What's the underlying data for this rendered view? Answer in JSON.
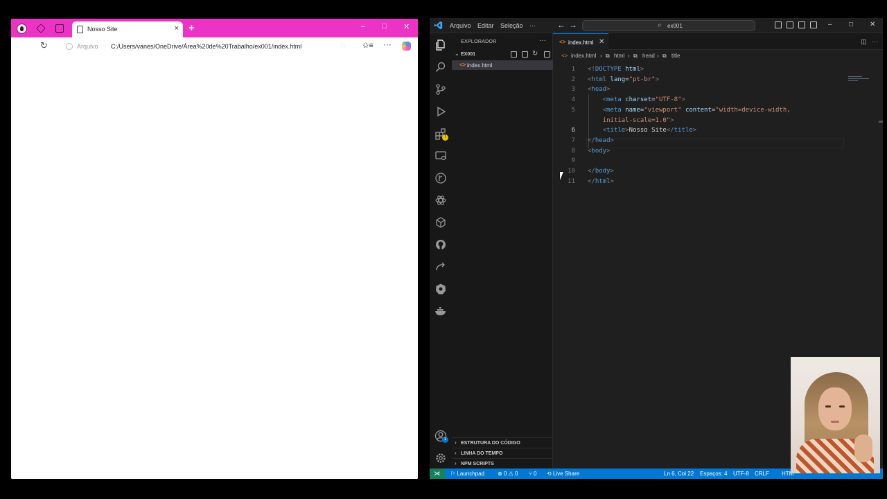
{
  "browser": {
    "tab_title": "Nosso Site",
    "new_tab_symbol": "+",
    "tab_close_symbol": "×",
    "file_label": "Arquivo",
    "url": "C:/Users/vanes/OneDrive/Área%20de%20Trabalho/ex001/index.html",
    "titlebar_color": "#ec33c5",
    "window_controls": [
      "–",
      "□",
      "✕"
    ]
  },
  "vscode": {
    "menu": [
      "Arquivo",
      "Editar",
      "Seleção",
      "···"
    ],
    "search_text": "ex001",
    "explorer_title": "EXPLORADOR",
    "explorer_more": "···",
    "folder_name": "EX001",
    "file_name": "index.html",
    "sidebar_sections": [
      "ESTRUTURA DO CÓDIGO",
      "LINHA DO TEMPO",
      "NPM SCRIPTS"
    ],
    "editor_tab": "index.html",
    "breadcrumbs": [
      "index.html",
      "html",
      "head",
      "title"
    ],
    "window_controls": [
      "–",
      "□",
      "✕"
    ],
    "accent_color": "#0078d4",
    "code_lines": [
      {
        "n": "1",
        "html": "<span class='tg'>&lt;!</span><span class='tn'>DOCTYPE</span> <span class='at'>html</span><span class='tg'>&gt;</span>"
      },
      {
        "n": "2",
        "html": "<span class='tg'>&lt;</span><span class='tn'>html</span> <span class='at'>lang</span><span class='tx'>=</span><span class='sv'>\"pt-br\"</span><span class='tg'>&gt;</span>"
      },
      {
        "n": "3",
        "html": "<span class='tg'>&lt;</span><span class='tn'>head</span><span class='tg'>&gt;</span>"
      },
      {
        "n": "4",
        "html": "    <span class='tg'>&lt;</span><span class='tn'>meta</span> <span class='at'>charset</span><span class='tx'>=</span><span class='sv'>\"UTF-8\"</span><span class='tg'>&gt;</span>"
      },
      {
        "n": "5",
        "html": "    <span class='tg'>&lt;</span><span class='tn'>meta</span> <span class='at'>name</span><span class='tx'>=</span><span class='sv'>\"viewport\"</span> <span class='at'>content</span><span class='tx'>=</span><span class='sv'>\"width=device-width,</span>"
      },
      {
        "n": "",
        "html": "    <span class='sv'>initial-scale=1.0\"</span><span class='tg'>&gt;</span>"
      },
      {
        "n": "6",
        "html": "    <span class='tg'>&lt;</span><span class='tn'>title</span><span class='tg'>&gt;</span><span class='tx'>Nosso Site</span><span class='tg'>&lt;/</span><span class='tn'>title</span><span class='tg'>&gt;</span>"
      },
      {
        "n": "7",
        "html": "<span class='tg'>&lt;/</span><span class='tn'>head</span><span class='tg'>&gt;</span>"
      },
      {
        "n": "8",
        "html": "<span class='tg'>&lt;</span><span class='tn'>body</span><span class='tg'>&gt;</span>"
      },
      {
        "n": "9",
        "html": ""
      },
      {
        "n": "10",
        "html": "<span class='tg'>&lt;/</span><span class='tn'>body</span><span class='tg'>&gt;</span>"
      },
      {
        "n": "11",
        "html": "<span class='tg'>&lt;/</span><span class='tn'>html</span><span class='tg'>&gt;</span>"
      }
    ],
    "status": {
      "launchpad": "Launchpad",
      "errors": "0",
      "warnings": "0",
      "ports": "0",
      "live_share": "Live Share",
      "position": "Ln 6, Col 22",
      "spaces": "Espaços: 4",
      "encoding": "UTF-8",
      "eol": "CRLF",
      "language": "HTM"
    }
  }
}
